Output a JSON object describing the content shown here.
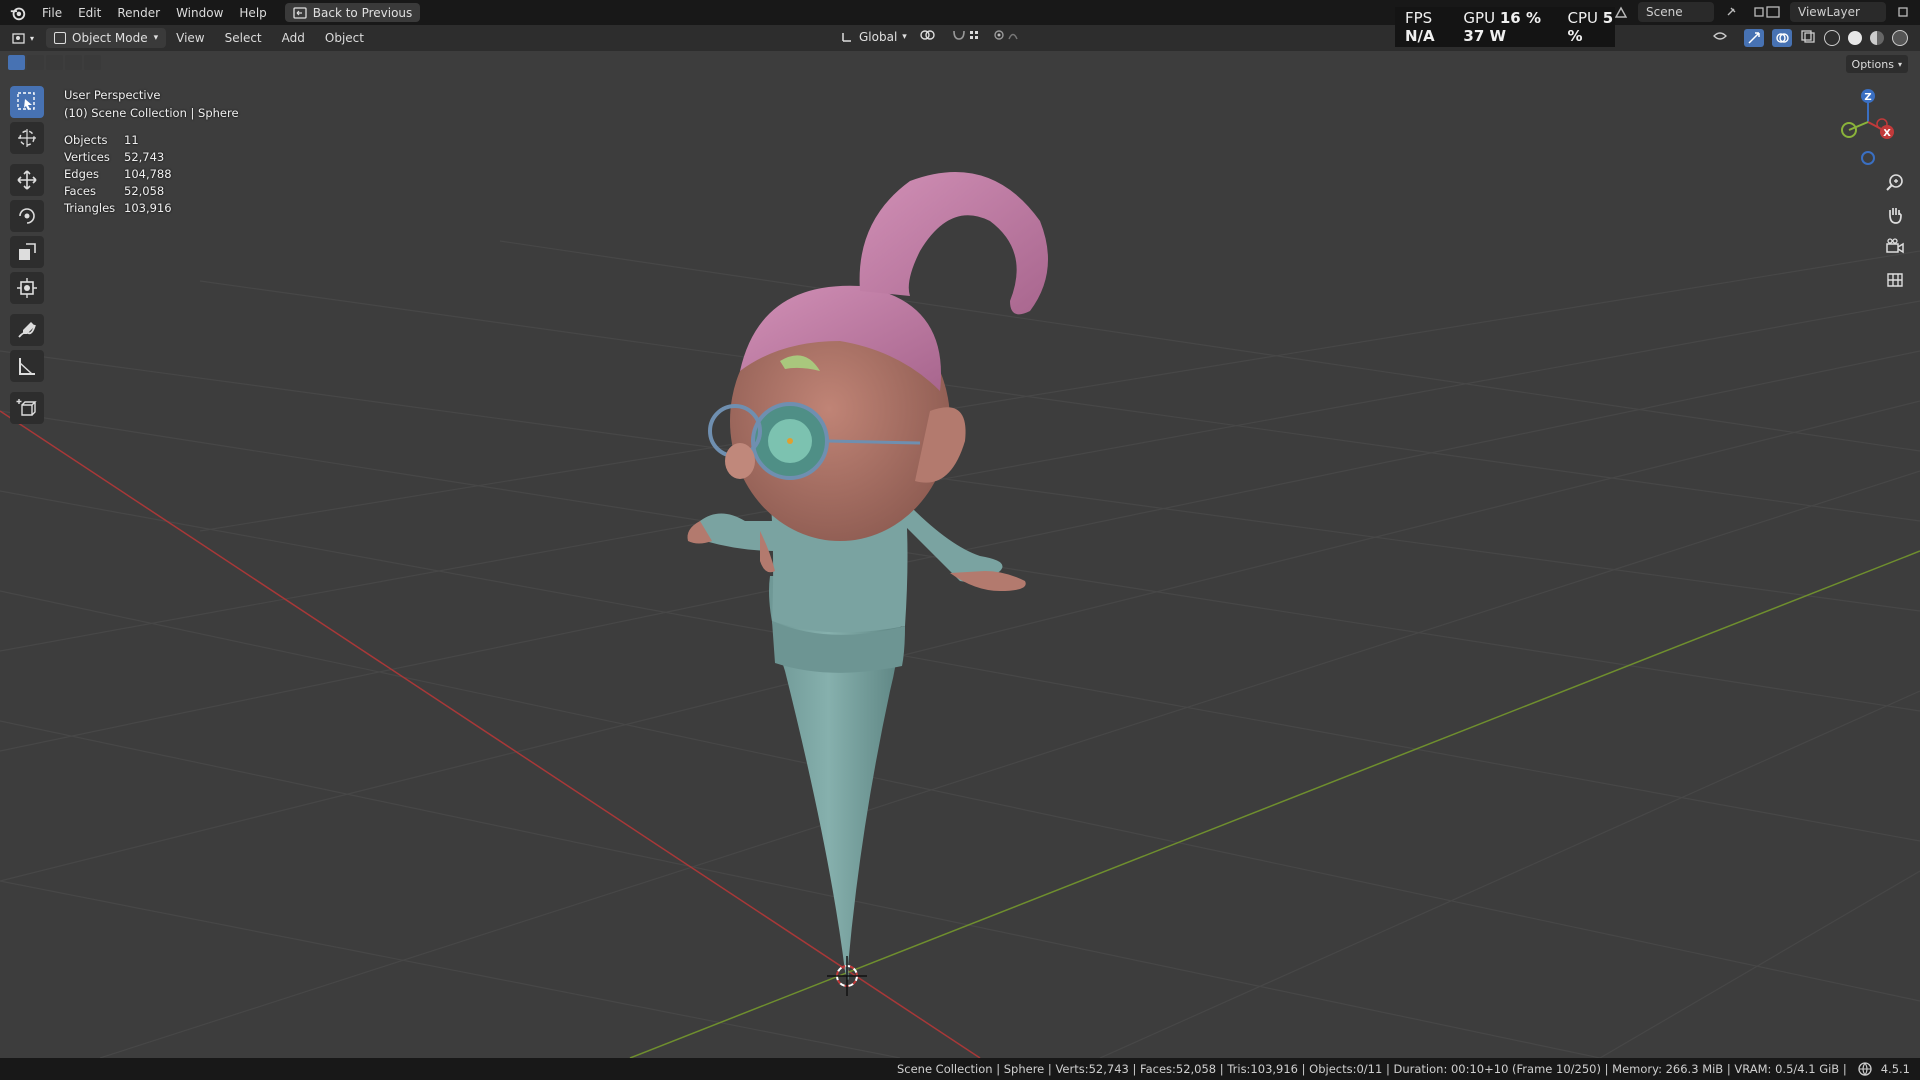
{
  "menu": {
    "items": [
      "File",
      "Edit",
      "Render",
      "Window",
      "Help"
    ],
    "back_button": "Back to Previous"
  },
  "scene": {
    "name": "Scene"
  },
  "view_layer": {
    "name": "ViewLayer"
  },
  "perf": {
    "fps_label": "FPS",
    "fps_value": "N/A",
    "gpu_label": "GPU",
    "gpu_value": "16 %",
    "gpu_power": "37 W",
    "cpu_label": "CPU",
    "cpu_value": "5 %"
  },
  "header": {
    "mode": "Object Mode",
    "menus": [
      "View",
      "Select",
      "Add",
      "Object"
    ],
    "orientation": "Global",
    "options_label": "Options"
  },
  "viewport_overlay": {
    "perspective": "User Perspective",
    "collection": "(10) Scene Collection | Sphere",
    "stats": [
      {
        "label": "Objects",
        "value": "11"
      },
      {
        "label": "Vertices",
        "value": "52,743"
      },
      {
        "label": "Edges",
        "value": "104,788"
      },
      {
        "label": "Faces",
        "value": "52,058"
      },
      {
        "label": "Triangles",
        "value": "103,916"
      }
    ]
  },
  "gizmo": {
    "z": "Z",
    "x": "X"
  },
  "status_bar": {
    "text": "Scene Collection | Sphere | Verts:52,743 | Faces:52,058 | Tris:103,916 | Objects:0/11 | Duration: 00:10+10 (Frame 10/250) | Memory: 266.3 MiB | VRAM: 0.5/4.1 GiB |",
    "version": "4.5.1"
  },
  "colors": {
    "accent": "#4772b3",
    "axis_x": "#c23a3a",
    "axis_y": "#8ab33a",
    "body": "#7fa8a6",
    "hair": "#c47fa8",
    "skin": "#b37a6e"
  },
  "icons": [
    "blender-logo-icon",
    "back-icon",
    "select-box-icon",
    "cursor-icon",
    "move-icon",
    "rotate-icon",
    "scale-icon",
    "transform-icon",
    "annotate-icon",
    "measure-icon",
    "add-cube-icon",
    "zoom-icon",
    "hand-icon",
    "camera-icon",
    "grid-icon",
    "globe-icon"
  ]
}
